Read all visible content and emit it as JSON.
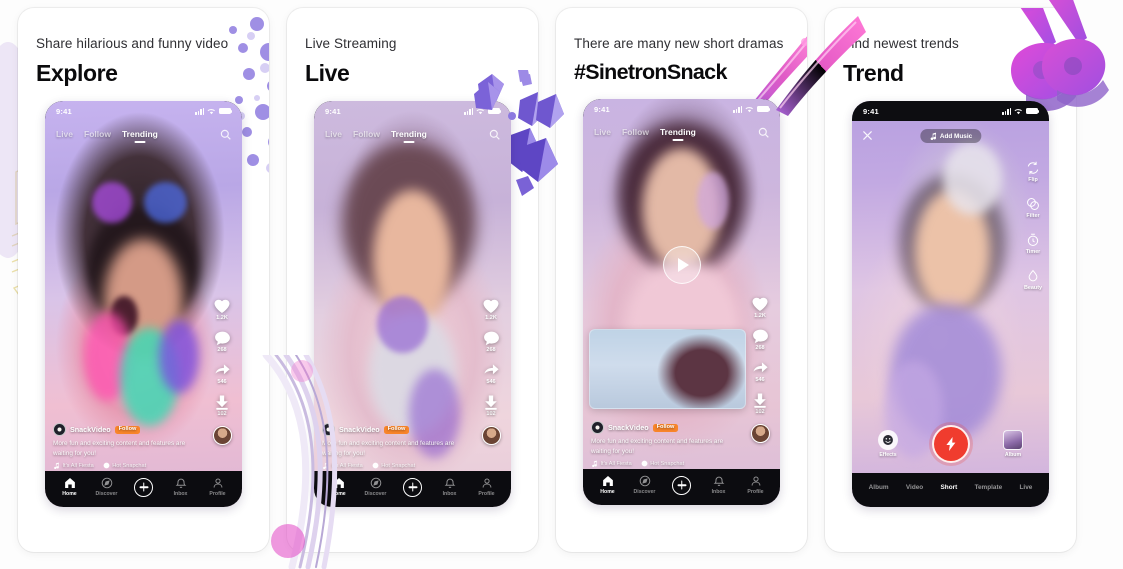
{
  "page": {
    "background": "#fdfdfd",
    "accent_orange": "#f8852a",
    "accent_red": "#f03c2e"
  },
  "cards": [
    {
      "kicker": "Share hilarious and funny video",
      "headline": "Explore",
      "decoration": "purple-confetti-splash",
      "phone": {
        "type": "feed",
        "status": {
          "time": "9:41"
        },
        "top_tabs": [
          {
            "label": "Live",
            "active": false
          },
          {
            "label": "Follow",
            "active": false
          },
          {
            "label": "Trending",
            "active": true
          }
        ],
        "rail": [
          {
            "icon": "heart-icon",
            "count": "1.2K"
          },
          {
            "icon": "comment-icon",
            "count": "268"
          },
          {
            "icon": "share-icon",
            "count": "546"
          },
          {
            "icon": "download-icon",
            "count": "102"
          }
        ],
        "caption": {
          "username": "SnackVideo",
          "follow_label": "Follow",
          "text": "More fun and exciting content and features are waiting for you!",
          "music": "It's All Fiesta",
          "tag": "Hot Snapchat"
        },
        "tabbar": [
          {
            "icon": "home-icon",
            "label": "Home",
            "active": true
          },
          {
            "icon": "compass-icon",
            "label": "Discover",
            "active": false
          },
          {
            "icon": "plus-icon",
            "label": "",
            "active": false
          },
          {
            "icon": "bell-icon",
            "label": "Inbox",
            "active": false
          },
          {
            "icon": "person-icon",
            "label": "Profile",
            "active": false
          }
        ]
      }
    },
    {
      "kicker": "Live Streaming",
      "headline": "Live",
      "decoration": "purple-crystals",
      "phone": {
        "type": "feed",
        "status": {
          "time": "9:41"
        },
        "top_tabs": [
          {
            "label": "Live",
            "active": false
          },
          {
            "label": "Follow",
            "active": false
          },
          {
            "label": "Trending",
            "active": true
          }
        ],
        "rail": [
          {
            "icon": "heart-icon",
            "count": "1.2K"
          },
          {
            "icon": "comment-icon",
            "count": "268"
          },
          {
            "icon": "share-icon",
            "count": "546"
          },
          {
            "icon": "download-icon",
            "count": "102"
          }
        ],
        "caption": {
          "username": "SnackVideo",
          "follow_label": "Follow",
          "text": "More fun and exciting content and features are waiting for you!",
          "music": "It's All Fiesta",
          "tag": "Hot Snapchat"
        },
        "tabbar": [
          {
            "icon": "home-icon",
            "label": "Home",
            "active": true
          },
          {
            "icon": "compass-icon",
            "label": "Discover",
            "active": false
          },
          {
            "icon": "plus-icon",
            "label": "",
            "active": false
          },
          {
            "icon": "bell-icon",
            "label": "Inbox",
            "active": false
          },
          {
            "icon": "person-icon",
            "label": "Profile",
            "active": false
          }
        ]
      }
    },
    {
      "kicker": "There are many new short dramas",
      "headline": "#SinetronSnack",
      "decoration": "magenta-paint-stroke",
      "phone": {
        "type": "feed-player",
        "status": {
          "time": "9:41"
        },
        "top_tabs": [
          {
            "label": "Live",
            "active": false
          },
          {
            "label": "Follow",
            "active": false
          },
          {
            "label": "Trending",
            "active": true
          }
        ],
        "play_button": "play-icon",
        "rail": [
          {
            "icon": "heart-icon",
            "count": "1.2K"
          },
          {
            "icon": "comment-icon",
            "count": "268"
          },
          {
            "icon": "share-icon",
            "count": "546"
          },
          {
            "icon": "download-icon",
            "count": "102"
          }
        ],
        "caption": {
          "username": "SnackVideo",
          "follow_label": "Follow",
          "text": "More fun and exciting content and features are waiting for you!",
          "music": "It's All Fiesta",
          "tag": "Hot Snapchat"
        },
        "tabbar": [
          {
            "icon": "home-icon",
            "label": "Home",
            "active": true
          },
          {
            "icon": "compass-icon",
            "label": "Discover",
            "active": false
          },
          {
            "icon": "plus-icon",
            "label": "",
            "active": false
          },
          {
            "icon": "bell-icon",
            "label": "Inbox",
            "active": false
          },
          {
            "icon": "person-icon",
            "label": "Profile",
            "active": false
          }
        ]
      }
    },
    {
      "kicker": "Find newest trends",
      "headline": "Trend",
      "decoration": "magenta-guitar",
      "phone": {
        "type": "camera",
        "status": {
          "time": "9:41"
        },
        "close_icon": "close-icon",
        "add_music_label": "Add Music",
        "cam_rail": [
          {
            "icon": "flip-camera-icon",
            "label": "Flip"
          },
          {
            "icon": "filter-icon",
            "label": "Filter"
          },
          {
            "icon": "timer-icon",
            "label": "Timer"
          },
          {
            "icon": "beauty-icon",
            "label": "Beauty"
          }
        ],
        "effects_label": "Effects",
        "album_label": "Album",
        "shutter_icon": "lightning-icon",
        "cam_tabs": [
          {
            "label": "Album",
            "active": false
          },
          {
            "label": "Video",
            "active": false
          },
          {
            "label": "Short",
            "active": true
          },
          {
            "label": "Template",
            "active": false
          },
          {
            "label": "Live",
            "active": false
          }
        ]
      }
    }
  ]
}
